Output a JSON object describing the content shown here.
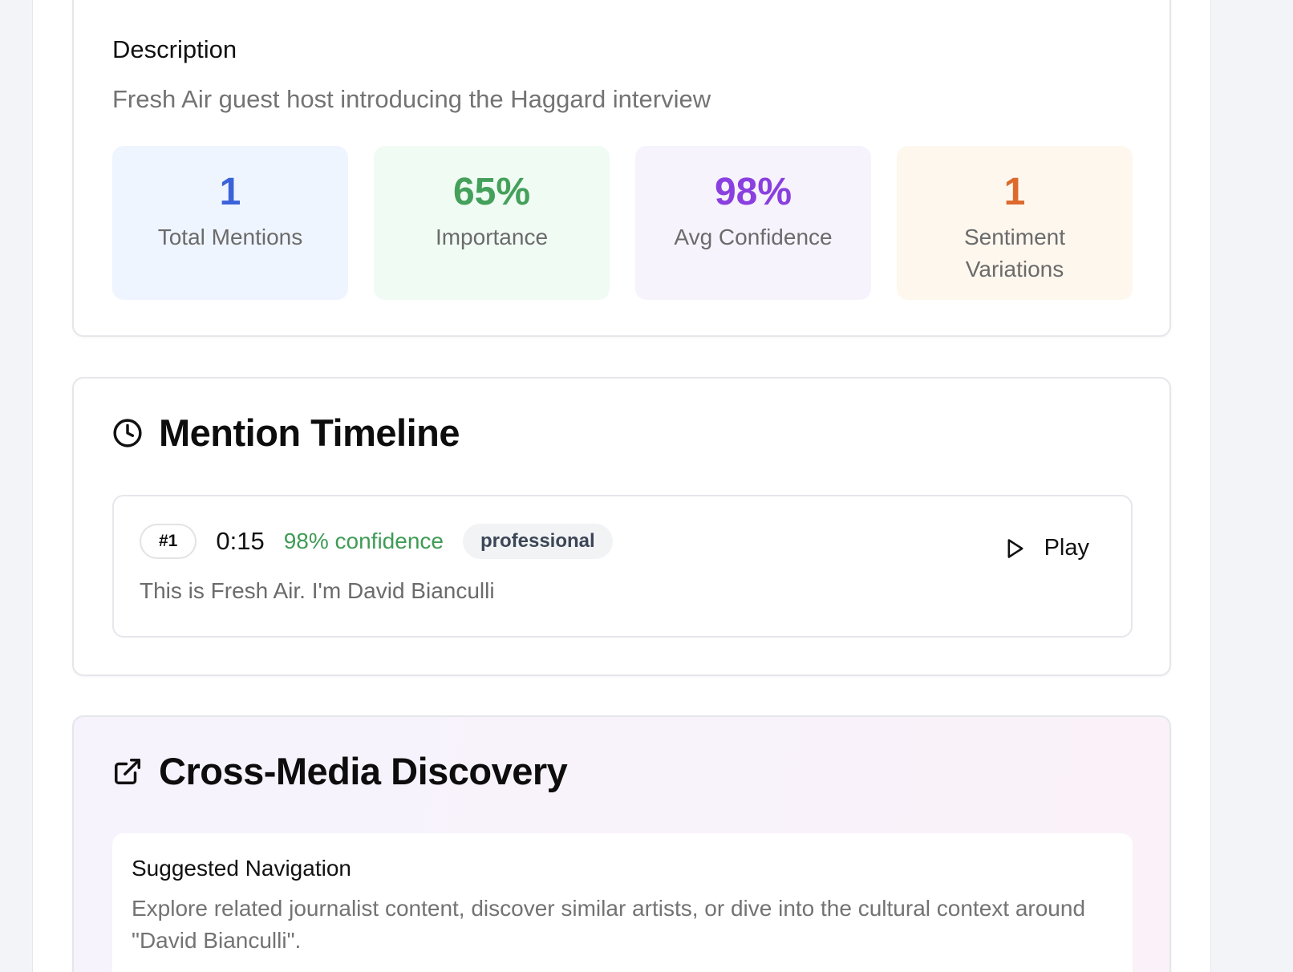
{
  "overview": {
    "description_heading": "Description",
    "description_text": "Fresh Air guest host introducing the Haggard interview",
    "stats": [
      {
        "value": "1",
        "label": "Total Mentions",
        "color": "#3b63d9"
      },
      {
        "value": "65%",
        "label": "Importance",
        "color": "#44a05a"
      },
      {
        "value": "98%",
        "label": "Avg Confidence",
        "color": "#8a3fe0"
      },
      {
        "value": "1",
        "label": "Sentiment Variations",
        "color": "#dd6a2c"
      }
    ]
  },
  "timeline": {
    "title": "Mention Timeline",
    "icon": "clock-icon",
    "mentions": [
      {
        "number": "#1",
        "time": "0:15",
        "confidence": "98% confidence",
        "tone": "professional",
        "quote": "This is Fresh Air. I'm David Bianculli",
        "play_label": "Play"
      }
    ]
  },
  "discovery": {
    "title": "Cross-Media Discovery",
    "icon": "external-link-icon",
    "suggest_title": "Suggested Navigation",
    "suggest_text": "Explore related journalist content, discover similar artists, or dive into the cultural context around \"David Bianculli\"."
  }
}
